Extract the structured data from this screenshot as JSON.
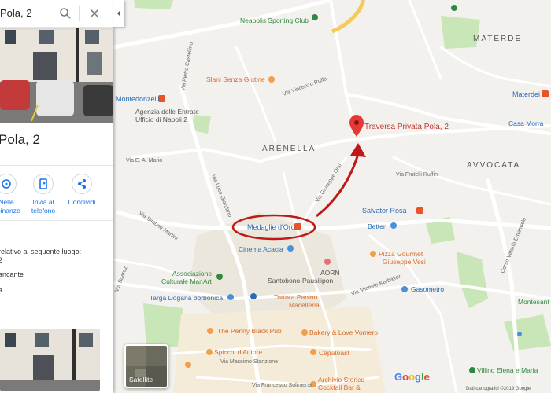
{
  "search": {
    "query": "Pola, 2"
  },
  "panel": {
    "title": "Pola, 2",
    "actions": [
      {
        "label_1": "Nelle",
        "label_2": "vicinanze"
      },
      {
        "label_1": "Invia al",
        "label_2": "telefono"
      },
      {
        "label_1": "Condividi",
        "label_2": ""
      }
    ],
    "info_lines": [
      "relativo al seguente luogo:",
      "2",
      "ancante",
      "a"
    ]
  },
  "map": {
    "districts": [
      "MATERDEI",
      "ARENELLA",
      "AVVOCATA"
    ],
    "destination_label": "Traversa Privata Pola, 2",
    "circled_station": "Medaglie d'Oro",
    "stations": [
      "Montedonzelli",
      "Materdei",
      "Salvator Rosa",
      "Medaglie d'Oro"
    ],
    "places": [
      "Neapolis Sporting Club",
      "Slani Senza Glutine",
      "Agenzia delle Entrate",
      "Ufficio di Napoli 2",
      "Casa Morra",
      "Better",
      "Cinema Acacia",
      "Pizza Gourmet",
      "Giuseppe Vesi",
      "Associazione",
      "Culturale ManArt",
      "Santobono-Pausilipon",
      "AORN",
      "Gasometro",
      "Targa Dogana borbonica",
      "Tortora Panino",
      "Macelleria",
      "The Penny Black Pub",
      "Bakery & Love Vomero",
      "Capatoast",
      "Spicchi d'Autore",
      "Archivio Storico",
      "Cocktail Bar &",
      "Villino Elena e Maria",
      "Montesant"
    ],
    "streets": [
      "Via Pietro Castellino",
      "Via E. A. Mario",
      "Via Simone Martini",
      "Via Giuseppe Orsi",
      "Via Suarez",
      "Via Massimo Stanzione",
      "Via Francesco Solimena",
      "Corso Vittorio Emanuele",
      "Via Michele Kerbaker",
      "Via Luca Giordano",
      "Via Vincenzo Ruffo",
      "Via Fratelli Ruffini"
    ]
  },
  "controls": {
    "satellite_label": "Satellite"
  },
  "footer": {
    "logo": "Google",
    "credit": "Dati cartografici ©2019 Google"
  },
  "colors": {
    "route_arrow": "#cc1f1f",
    "marker": "#e53935",
    "metro": "#e8542a",
    "park": "#c7e6b4",
    "place_label": "#d96a2a",
    "place_label_blue": "#2a6bb5"
  }
}
